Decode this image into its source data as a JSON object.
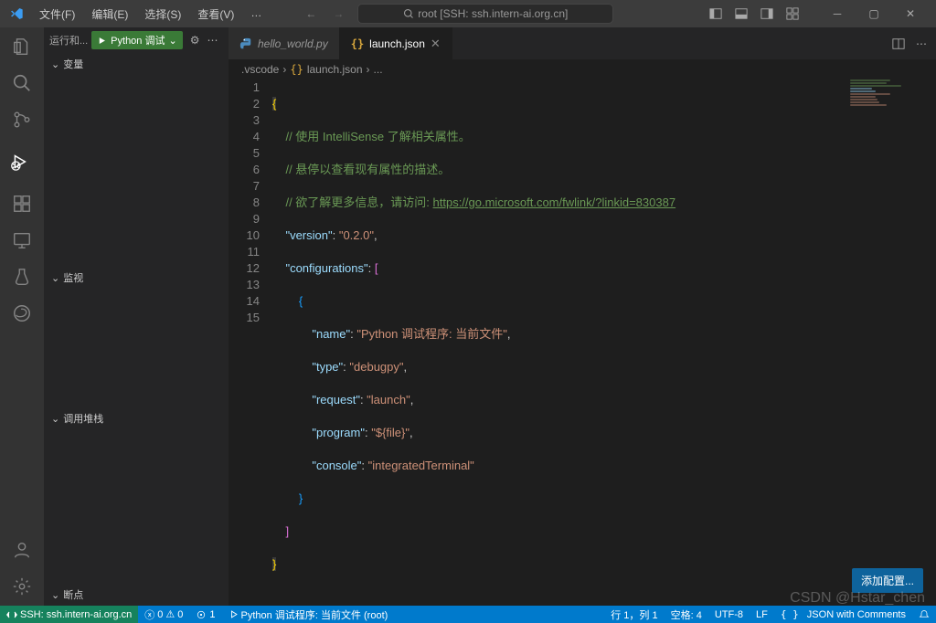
{
  "titlebar": {
    "menus": [
      "文件(F)",
      "编辑(E)",
      "选择(S)",
      "查看(V)",
      "…"
    ],
    "search_prefix": "root [SSH: ssh.intern-ai.org.cn]"
  },
  "sidebar": {
    "run_label": "运行和...",
    "debug_config": "Python 调试",
    "sections": {
      "vars": "变量",
      "watch": "监视",
      "callstack": "调用堆栈",
      "breakpoints": "断点"
    }
  },
  "tabs": {
    "file1": "hello_world.py",
    "file2": "launch.json"
  },
  "breadcrumb": {
    "folder": ".vscode",
    "file": "launch.json",
    "more": "..."
  },
  "code": {
    "lines": [
      "1",
      "2",
      "3",
      "4",
      "5",
      "6",
      "7",
      "8",
      "9",
      "10",
      "11",
      "12",
      "13",
      "14",
      "15"
    ],
    "c2": "// 使用 IntelliSense 了解相关属性。",
    "c3": "// 悬停以查看现有属性的描述。",
    "c4a": "// 欲了解更多信息，请访问: ",
    "c4b": "https://go.microsoft.com/fwlink/?linkid=830387",
    "k_version": "\"version\"",
    "v_version": "\"0.2.0\"",
    "k_configs": "\"configurations\"",
    "k_name": "\"name\"",
    "v_name": "\"Python 调试程序: 当前文件\"",
    "k_type": "\"type\"",
    "v_type": "\"debugpy\"",
    "k_request": "\"request\"",
    "v_request": "\"launch\"",
    "k_program": "\"program\"",
    "v_program": "\"${file}\"",
    "k_console": "\"console\"",
    "v_console": "\"integratedTerminal\""
  },
  "add_config": "添加配置...",
  "status": {
    "remote": "SSH: ssh.intern-ai.org.cn",
    "errors": "0",
    "warnings": "0",
    "ports": "1",
    "debug": "Python 调试程序: 当前文件 (root)",
    "ln_col": "行 1，列 1",
    "spaces": "空格: 4",
    "encoding": "UTF-8",
    "eol": "LF",
    "lang": "JSON with Comments"
  },
  "watermark": "CSDN @Hstar_chen"
}
